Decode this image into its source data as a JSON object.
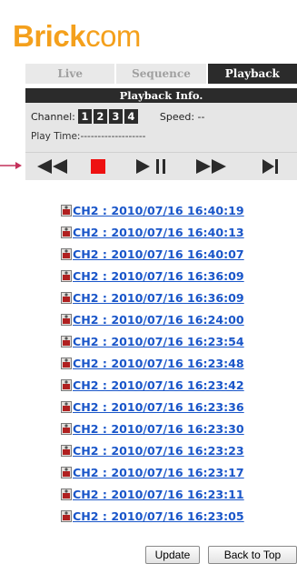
{
  "brand": {
    "part1": "Brick",
    "part2": "com",
    "color": "#f4a01c"
  },
  "tabs": [
    {
      "label": "Live",
      "active": false
    },
    {
      "label": "Sequence",
      "active": false
    },
    {
      "label": "Playback",
      "active": true
    }
  ],
  "info": {
    "title": "Playback Info.",
    "channel_label": "Channel:",
    "channels": [
      "1",
      "2",
      "3",
      "4"
    ],
    "speed_label": "Speed: --",
    "play_time_label": "Play Time:-------------------"
  },
  "controls": [
    "rewind-icon",
    "stop-icon",
    "play-pause-icon",
    "fast-forward-icon",
    "next-frame-icon"
  ],
  "recordings": [
    "CH2 : 2010/07/16 16:40:19",
    "CH2 : 2010/07/16 16:40:13",
    "CH2 : 2010/07/16 16:40:07",
    "CH2 : 2010/07/16 16:36:09",
    "CH2 : 2010/07/16 16:36:09",
    "CH2 : 2010/07/16 16:24:00",
    "CH2 : 2010/07/16 16:23:54",
    "CH2 : 2010/07/16 16:23:48",
    "CH2 : 2010/07/16 16:23:42",
    "CH2 : 2010/07/16 16:23:36",
    "CH2 : 2010/07/16 16:23:30",
    "CH2 : 2010/07/16 16:23:23",
    "CH2 : 2010/07/16 16:23:17",
    "CH2 : 2010/07/16 16:23:11",
    "CH2 : 2010/07/16 16:23:05"
  ],
  "buttons": {
    "update": "Update",
    "back_to_top": "Back to Top"
  },
  "colors": {
    "link": "#1a56c9",
    "stop": "#ee1111",
    "indicator": "#c4305a",
    "dark": "#2b2b2b"
  }
}
